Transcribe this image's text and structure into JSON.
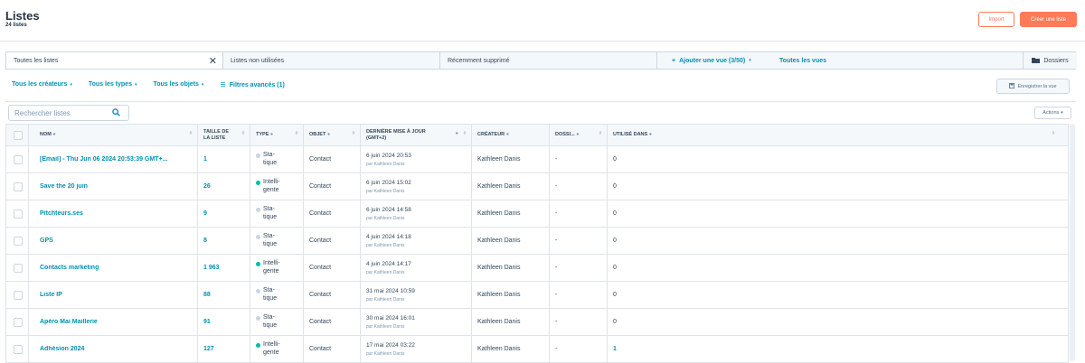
{
  "header": {
    "title": "Listes",
    "count": "24 listes",
    "import_label": "Import",
    "create_label": "Créer une liste"
  },
  "tabs": [
    {
      "label": "Toutes les listes",
      "active": true
    },
    {
      "label": "Listes non utilisées",
      "active": false
    },
    {
      "label": "Récemment supprimé",
      "active": false
    }
  ],
  "views": {
    "add_label": "Ajouter une vue (3/50)",
    "all_views_label": "Toutes les vues",
    "folders_label": "Dossiers"
  },
  "filters": {
    "creators": "Tous les créateurs",
    "types": "Tous les types",
    "objects": "Tous les objets",
    "advanced": "Filtres avancés (1)",
    "save_view_label": "Enregistrer la vue"
  },
  "search": {
    "placeholder": "Rechercher listes"
  },
  "actions_label": "Actions",
  "table": {
    "columns": {
      "name": "NOM",
      "size": "TAILLE DE LA LISTE",
      "type": "TYPE",
      "object": "OBJET",
      "updated": "DERNIÈRE MISE À JOUR (GMT+2)",
      "creator": "CRÉATEUR",
      "folder": "DOSSI...",
      "used_in": "UTILISÉ DANS"
    },
    "rows": [
      {
        "name": "[Email] - Thu Jun 06 2024 20:53:39 GMT+...",
        "size": "1",
        "type_l1": "Sta-",
        "type_l2": "tique",
        "type_color": "#cbd6e2",
        "object": "Contact",
        "date": "6 juin 2024 20:53",
        "by": "par Kathleen Danis",
        "creator": "Kathleen Danis",
        "folder": "-",
        "used": "0"
      },
      {
        "name": "Save the 20 juin",
        "size": "26",
        "type_l1": "Intelli-",
        "type_l2": "gente",
        "type_color": "#00bda5",
        "object": "Contact",
        "date": "6 juin 2024 15:02",
        "by": "par Kathleen Danis",
        "creator": "Kathleen Danis",
        "folder": "-",
        "used": "0"
      },
      {
        "name": "Pitchteurs.ses",
        "size": "9",
        "type_l1": "Sta-",
        "type_l2": "tique",
        "type_color": "#cbd6e2",
        "object": "Contact",
        "date": "6 juin 2024 14:58",
        "by": "par Kathleen Danis",
        "creator": "Kathleen Danis",
        "folder": "-",
        "used": "0"
      },
      {
        "name": "GPS",
        "size": "8",
        "type_l1": "Sta-",
        "type_l2": "tique",
        "type_color": "#cbd6e2",
        "object": "Contact",
        "date": "4 juin 2024 14:18",
        "by": "par Kathleen Danis",
        "creator": "Kathleen Danis",
        "folder": "-",
        "used": "0"
      },
      {
        "name": "Contacts marketing",
        "size": "1 963",
        "type_l1": "Intelli-",
        "type_l2": "gente",
        "type_color": "#00bda5",
        "object": "Contact",
        "date": "4 juin 2024 14:17",
        "by": "par Kathleen Danis",
        "creator": "Kathleen Danis",
        "folder": "-",
        "used": "0"
      },
      {
        "name": "Liste IP",
        "size": "88",
        "type_l1": "Sta-",
        "type_l2": "tique",
        "type_color": "#cbd6e2",
        "object": "Contact",
        "date": "31 mai 2024 10:59",
        "by": "par Kathleen Danis",
        "creator": "Kathleen Danis",
        "folder": "-",
        "used": "0"
      },
      {
        "name": "Apéro Mai Maillerie",
        "size": "91",
        "type_l1": "Sta-",
        "type_l2": "tique",
        "type_color": "#cbd6e2",
        "object": "Contact",
        "date": "30 mai 2024 16:01",
        "by": "par Kathleen Danis",
        "creator": "Kathleen Danis",
        "folder": "-",
        "used": "0"
      },
      {
        "name": "Adhésion 2024",
        "size": "127",
        "type_l1": "Intelli-",
        "type_l2": "gente",
        "type_color": "#00bda5",
        "object": "Contact",
        "date": "17 mai 2024 03:22",
        "by": "par Kathleen Danis",
        "creator": "Kathleen Danis",
        "folder": "-",
        "used": "1"
      }
    ]
  }
}
